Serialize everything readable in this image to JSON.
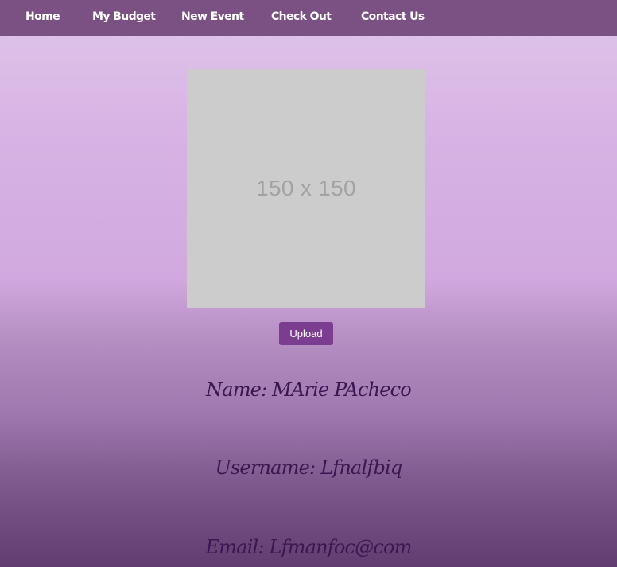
{
  "nav": {
    "items": [
      {
        "label": "Home"
      },
      {
        "label": "My Budget"
      },
      {
        "label": "New Event"
      },
      {
        "label": "Check Out"
      },
      {
        "label": "Contact Us"
      }
    ]
  },
  "profile": {
    "image_placeholder_text": "150 x 150",
    "upload_label": "Upload",
    "name_line": "Name: MArie PAcheco",
    "username_line": "Username: Lfnalfbiq",
    "email_line": "Email: Lfmanfoc@com"
  },
  "colors": {
    "navbar": "#7b5183",
    "upload_button": "#7a3d8f",
    "info_text": "#3b1752",
    "placeholder_bg": "#cccccc"
  }
}
